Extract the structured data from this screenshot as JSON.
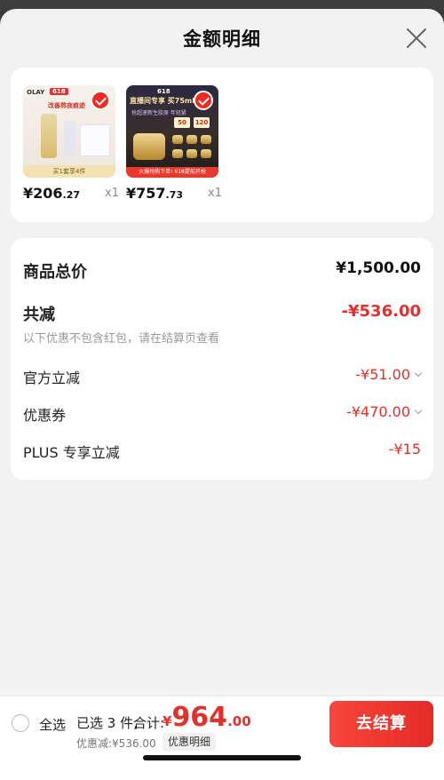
{
  "header": {
    "title": "金额明细"
  },
  "products": [
    {
      "price_int": "¥206",
      "price_dec": ".27",
      "qty": "x1",
      "thumb": {
        "brand": "OLAY",
        "badge": "618",
        "promo": "改善熬夜痕迹",
        "footer": "买1套享4件"
      }
    },
    {
      "price_int": "¥757",
      "price_dec": ".73",
      "qty": "x1",
      "thumb": {
        "badge": "618",
        "headline": "直播间专享 买75ml得",
        "sub": "抢超速新生胶原 年轻紧",
        "coupon1": "50",
        "coupon2": "120",
        "footer": "火爆抢购下单! 618提前开抢"
      }
    }
  ],
  "summary": {
    "total_label": "商品总价",
    "total_value": "¥1,500.00",
    "reduce_label": "共减",
    "reduce_value": "-¥536.00",
    "note": "以下优惠不包含红包，请在结算页查看",
    "details": [
      {
        "label": "官方立减",
        "value": "-¥51.00"
      },
      {
        "label": "优惠券",
        "value": "-¥470.00"
      },
      {
        "label": "PLUS 专享立减",
        "value": "-¥15"
      }
    ]
  },
  "bottom": {
    "select_all": "全选",
    "selected": "已选 3 件,",
    "sum_label": "合计:",
    "total_yen": "¥",
    "total_int": "964",
    "total_dec": ".00",
    "discount": "优惠减:¥536.00",
    "detail_btn": "优惠明细",
    "checkout": "去结算"
  },
  "colors": {
    "accent": "#e4302b",
    "background": "#f2f2f2"
  }
}
